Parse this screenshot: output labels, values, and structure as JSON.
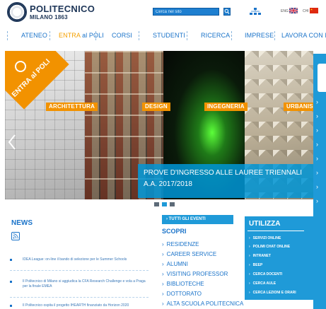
{
  "header": {
    "logo_name": "POLITECNICO",
    "logo_sub": "MILANO 1863",
    "search_placeholder": "Cerca nel sito",
    "lang_en": "ENG",
    "lang_ch": "CHI"
  },
  "nav": {
    "items": [
      {
        "label": "ATENEO"
      },
      {
        "label_hl": "ENTRA",
        "label": " al POLI"
      },
      {
        "label": "CORSI"
      },
      {
        "label": "STUDENTI"
      },
      {
        "label": "RICERCA"
      },
      {
        "label": "IMPRESE"
      },
      {
        "label": "LAVORA CON NOI"
      }
    ]
  },
  "hero": {
    "badge_text": "ENTRA al POLI",
    "categories": [
      "ARCHITETTURA",
      "DESIGN",
      "INGEGNERIA",
      "URBANISTICA"
    ],
    "caption": "PROVE D'INGRESSO ALLE LAUREE TRIENNALI A.A. 2017/2018",
    "slide_count": 3,
    "active_slide": 2
  },
  "news": {
    "title": "NEWS",
    "items": [
      "IDEA League: on-line il bando di selezione per le Summer Schools",
      "Il Politecnico di Milano si aggiudica la CFA Research Challenge e vola a Praga per la finale EMEA",
      "Il Politecnico ospita il progetto IHEARTH finanziato da Horizon 2020"
    ]
  },
  "events": {
    "button_label": "TUTTI GLI EVENTI"
  },
  "scopri": {
    "title": "SCOPRI",
    "items": [
      "RESIDENZE",
      "CAREER SERVICE",
      "ALUMNI",
      "VISITING PROFESSOR",
      "BIBLIOTECHE",
      "DOTTORATO",
      "ALTA SCUOLA POLITECNICA"
    ]
  },
  "utilizza": {
    "title": "UTILIZZA",
    "items": [
      "SERVIZI ONLINE",
      "POLIMI CHAT ONLINE",
      "INTRANET",
      "BEEP",
      "CERCA DOCENTI",
      "CERCA AULE",
      "CERCA LEZIONI E ORARI"
    ]
  },
  "colors": {
    "brand_blue": "#1a73c9",
    "accent_orange": "#f29200",
    "panel_blue": "#1f9ad8"
  }
}
